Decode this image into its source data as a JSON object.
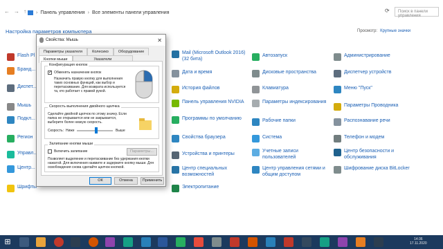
{
  "address": {
    "crumbs": [
      "Панель управления",
      "Все элементы панели управления"
    ],
    "search_placeholder": "Поиск в панели управления"
  },
  "heading": "Настройка параметров компьютера",
  "view_by": {
    "label": "Просмотр:",
    "value": "Крупные значки"
  },
  "items_col1": [
    "Flash Pl",
    "Бранд... Windo",
    "Диспет... задач",
    "Мышь",
    "Подкл... удален...",
    "Регион",
    "Управл...",
    "Центр... Windo",
    "Шрифты"
  ],
  "items_col2": [
    "Mail (Microsoft Outlook 2016) (32 бита)",
    "Дата и время",
    "История файлов",
    "Панель управления NVIDIA",
    "Программы по умолчанию",
    "Свойства браузера",
    "Устройства и принтеры",
    "Центр специальных возможностей",
    "Электропитание"
  ],
  "items_col3": [
    "Автозапуск",
    "Дисковые пространства",
    "Клавиатура",
    "Параметры индексирования",
    "Рабочие папки",
    "Система",
    "Учетные записи пользователей",
    "Центр управления сетями и общим доступом"
  ],
  "items_col4": [
    "Администрирование",
    "Диспетчер устройств",
    "Меню \"Пуск\"",
    "Параметры Проводника",
    "Распознавание речи",
    "Телефон и модем",
    "Центр безопасности и обслуживания",
    "Шифрование диска BitLocker"
  ],
  "dialog": {
    "title": "Свойства: Мышь",
    "tabs_row1": [
      "Параметры указателя",
      "Колесико",
      "Оборудование"
    ],
    "tabs_row2": [
      "Кнопки мыши",
      "Указатели"
    ],
    "group1_title": "Конфигурация кнопок",
    "swap_label": "Обменять назначение кнопок",
    "swap_desc": "Назначить правую кнопку для выполнения таких основных функций, как выбор и перетаскивание. Для возврата используется та, кто работает с правой рукой.",
    "group2_title": "Скорость выполнения двойного щелчка",
    "speed_desc": "Сделайте двойной щелчок по этому значку. Если папка не открывается или не закрывается, выберите более низкую скорость.",
    "speed_label": "Скорость:",
    "slow": "Ниже",
    "fast": "Выше",
    "group3_title": "Залипание кнопки мыши",
    "sticky_label": "Включить залипание",
    "params_button": "Параметры...",
    "sticky_desc": "Позволяет выделение и перетаскивание без удержания кнопки нажатой. Для включения нажмите и задержите кнопку мыши. Для освобождения снова сделайте щелчок кнопкой.",
    "ok": "ОК",
    "cancel": "Отмена",
    "apply": "Применить"
  },
  "tray": {
    "time": "14:36",
    "date": "17.11.2020"
  }
}
